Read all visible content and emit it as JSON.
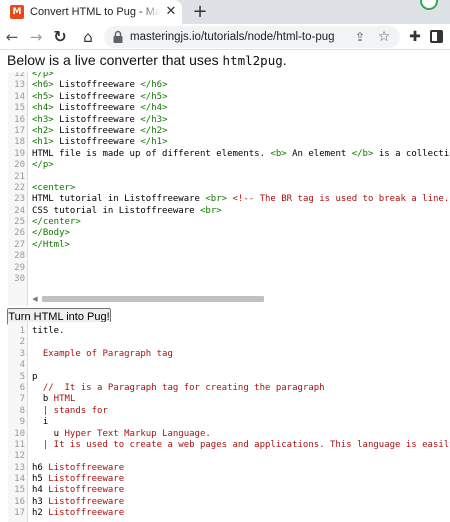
{
  "browser": {
    "tab": {
      "title": "Convert HTML to Pug - Mastering JS",
      "favicon": "M",
      "close_glyph": "✕"
    },
    "new_tab_glyph": "+",
    "url": "masteringjs.io/tutorials/node/html-to-pug",
    "icons": [
      "back-arrow-icon",
      "forward-arrow-icon",
      "reload-icon",
      "home-icon",
      "lock-icon",
      "share-icon",
      "star-icon",
      "extensions-puzzle-icon",
      "side-panel-icon"
    ]
  },
  "page": {
    "intro_text": "Below is a live converter that uses ",
    "intro_code": "html2pug",
    "intro_end": ".",
    "button_label": "Turn HTML into Pug!"
  },
  "html_editor": {
    "lines": [
      {
        "n": "12",
        "t": "</p>"
      },
      {
        "n": "13",
        "t": "<h6> Listoffreeware </h6>"
      },
      {
        "n": "14",
        "t": "<h5> Listoffreeware </h5>"
      },
      {
        "n": "15",
        "t": "<h4> Listoffreeware </h4>"
      },
      {
        "n": "16",
        "t": "<h3> Listoffreeware </h3>"
      },
      {
        "n": "17",
        "t": "<h2> Listoffreeware </h2>"
      },
      {
        "n": "18",
        "t": "<h1> Listoffreeware </h1>"
      },
      {
        "n": "19",
        "t": "HTML file is made up of different elements. <b> An element </b> is a collectio"
      },
      {
        "n": "20",
        "t": "</p>"
      },
      {
        "n": "21",
        "t": ""
      },
      {
        "n": "22",
        "t": "<center>"
      },
      {
        "n": "23",
        "t": "HTML tutorial in Listoffreeware <br> <!-- The BR tag is used to break a line."
      },
      {
        "n": "24",
        "t": "CSS tutorial in Listoffreeware <br>"
      },
      {
        "n": "25",
        "t": "</center>"
      },
      {
        "n": "26",
        "t": "</Body>"
      },
      {
        "n": "27",
        "t": "</Html>"
      },
      {
        "n": "28",
        "t": ""
      },
      {
        "n": "29",
        "t": ""
      },
      {
        "n": "30",
        "t": ""
      }
    ]
  },
  "pug_editor": {
    "lines": [
      {
        "n": "1",
        "t": "title."
      },
      {
        "n": "2",
        "t": ""
      },
      {
        "n": "3",
        "t": "  Example of Paragraph tag"
      },
      {
        "n": "4",
        "t": ""
      },
      {
        "n": "5",
        "t": "p"
      },
      {
        "n": "6",
        "t": "  //  It is a Paragraph tag for creating the paragraph"
      },
      {
        "n": "7",
        "t": "  b HTML"
      },
      {
        "n": "8",
        "t": "  | stands for"
      },
      {
        "n": "9",
        "t": "  i"
      },
      {
        "n": "10",
        "t": "    u Hyper Text Markup Language."
      },
      {
        "n": "11",
        "t": "  | It is used to create a web pages and applications. This language is easily"
      },
      {
        "n": "12",
        "t": ""
      },
      {
        "n": "13",
        "t": "h6 Listoffreeware"
      },
      {
        "n": "14",
        "t": "h5 Listoffreeware"
      },
      {
        "n": "15",
        "t": "h4 Listoffreeware"
      },
      {
        "n": "16",
        "t": "h3 Listoffreeware"
      },
      {
        "n": "17",
        "t": "h2 Listoffreeware"
      }
    ]
  },
  "colors": {
    "tag": "#117700",
    "pug_text": "#aa1111",
    "gutter": "#f7f7f7"
  }
}
